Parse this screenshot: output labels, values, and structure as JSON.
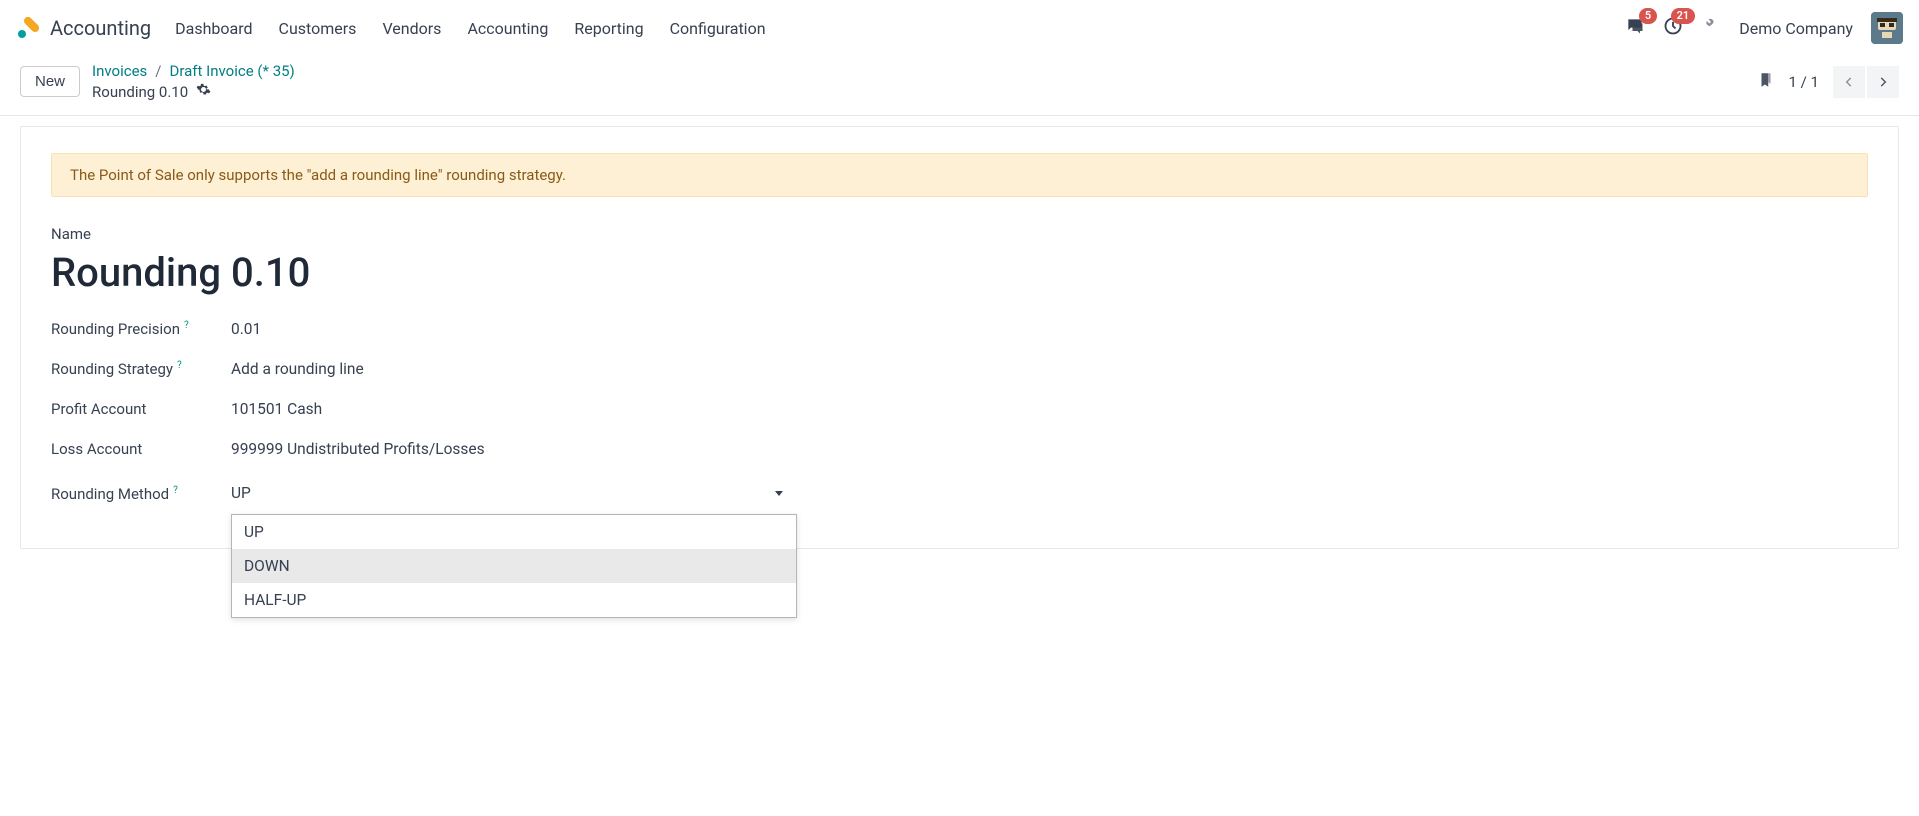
{
  "nav": {
    "app": "Accounting",
    "items": [
      "Dashboard",
      "Customers",
      "Vendors",
      "Accounting",
      "Reporting",
      "Configuration"
    ],
    "messages_badge": "5",
    "activities_badge": "21",
    "company": "Demo Company"
  },
  "control": {
    "new_label": "New",
    "crumb1": "Invoices",
    "crumb2": "Draft Invoice (* 35)",
    "current": "Rounding 0.10",
    "pager": "1 / 1"
  },
  "alert_text": "The Point of Sale only supports the \"add a rounding line\" rounding strategy.",
  "form": {
    "name_label": "Name",
    "name_value": "Rounding 0.10",
    "precision_label": "Rounding Precision",
    "precision_value": "0.01",
    "strategy_label": "Rounding Strategy",
    "strategy_value": "Add a rounding line",
    "profit_label": "Profit Account",
    "profit_value": "101501 Cash",
    "loss_label": "Loss Account",
    "loss_value": "999999 Undistributed Profits/Losses",
    "method_label": "Rounding Method",
    "method_value": "UP",
    "method_options": [
      "UP",
      "DOWN",
      "HALF-UP"
    ]
  }
}
